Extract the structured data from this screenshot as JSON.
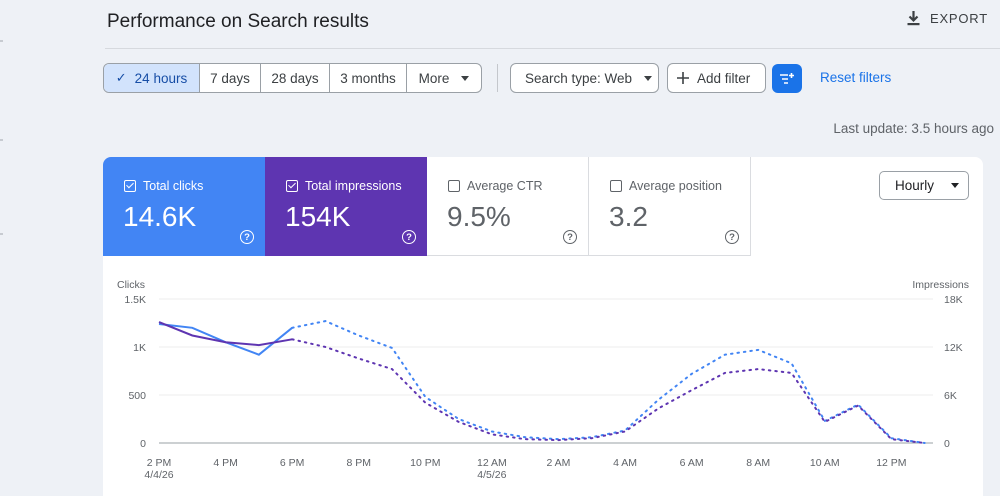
{
  "header": {
    "title": "Performance on Search results",
    "export_label": "EXPORT"
  },
  "toolbar": {
    "ranges": [
      {
        "label": "24 hours",
        "active": true
      },
      {
        "label": "7 days",
        "active": false
      },
      {
        "label": "28 days",
        "active": false
      },
      {
        "label": "3 months",
        "active": false
      },
      {
        "label": "More",
        "active": false
      }
    ],
    "search_type_label": "Search type: Web",
    "add_filter_label": "Add filter",
    "reset_filters_label": "Reset filters"
  },
  "last_update": "Last update: 3.5 hours ago",
  "metrics": [
    {
      "label": "Total clicks",
      "value": "14.6K",
      "checked": true
    },
    {
      "label": "Total impressions",
      "value": "154K",
      "checked": true
    },
    {
      "label": "Average CTR",
      "value": "9.5%",
      "checked": false
    },
    {
      "label": "Average position",
      "value": "3.2",
      "checked": false
    }
  ],
  "help_glyph": "?",
  "granularity_label": "Hourly",
  "colors": {
    "clicks": "#4285f4",
    "impressions": "#5e35b1",
    "accent": "#1a73e8"
  },
  "chart_data": {
    "type": "line",
    "left_axis_label": "Clicks",
    "right_axis_label": "Impressions",
    "left_ticks": [
      "0",
      "500",
      "1K",
      "1.5K"
    ],
    "right_ticks": [
      "0",
      "6K",
      "12K",
      "18K"
    ],
    "ylim_left": [
      0,
      1500
    ],
    "ylim_right": [
      0,
      18000
    ],
    "x_tick_labels": [
      {
        "line1": "2 PM",
        "line2": "4/4/26"
      },
      {
        "line1": "4 PM",
        "line2": ""
      },
      {
        "line1": "6 PM",
        "line2": ""
      },
      {
        "line1": "8 PM",
        "line2": ""
      },
      {
        "line1": "10 PM",
        "line2": ""
      },
      {
        "line1": "12 AM",
        "line2": "4/5/26"
      },
      {
        "line1": "2 AM",
        "line2": ""
      },
      {
        "line1": "4 AM",
        "line2": ""
      },
      {
        "line1": "6 AM",
        "line2": ""
      },
      {
        "line1": "8 AM",
        "line2": ""
      },
      {
        "line1": "10 AM",
        "line2": ""
      },
      {
        "line1": "12 PM",
        "line2": ""
      }
    ],
    "hours_from_start": [
      0,
      1,
      2,
      3,
      4,
      5,
      6,
      7,
      8,
      9,
      10,
      11,
      12,
      13,
      14,
      15,
      16,
      17,
      18,
      19,
      20,
      21,
      22,
      23
    ],
    "complete_through_index": 4,
    "grid": true,
    "series": [
      {
        "key": "clicks",
        "axis": "left",
        "style": "solid-then-dotted",
        "values": [
          1240,
          1200,
          1050,
          920,
          1200,
          1270,
          1120,
          990,
          480,
          250,
          120,
          60,
          40,
          60,
          130,
          450,
          720,
          920,
          970,
          830,
          230,
          400,
          50,
          0
        ]
      },
      {
        "key": "impressions",
        "axis": "left",
        "style": "solid-then-dotted",
        "values": [
          1260,
          1120,
          1050,
          1020,
          1080,
          1000,
          880,
          770,
          420,
          220,
          90,
          40,
          30,
          50,
          120,
          360,
          550,
          730,
          770,
          730,
          220,
          390,
          40,
          0
        ]
      }
    ]
  }
}
